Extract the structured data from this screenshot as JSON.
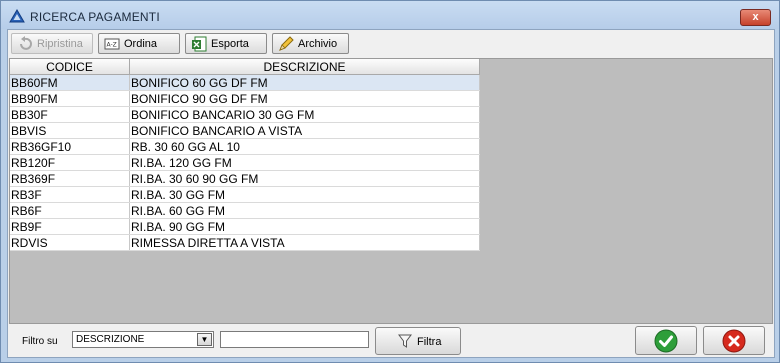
{
  "window": {
    "title": "RICERCA PAGAMENTI",
    "close_label": "x"
  },
  "toolbar": {
    "ripristina_label": "Ripristina",
    "ordina_label": "Ordina",
    "esporta_label": "Esporta",
    "archivio_label": "Archivio"
  },
  "table": {
    "headers": [
      "CODICE",
      "DESCRIZIONE"
    ],
    "rows": [
      [
        "BB60FM",
        "BONIFICO 60 GG DF FM"
      ],
      [
        "BB90FM",
        "BONIFICO 90 GG DF FM"
      ],
      [
        "BB30F",
        "BONIFICO BANCARIO 30 GG FM"
      ],
      [
        "BBVIS",
        "BONIFICO BANCARIO A VISTA"
      ],
      [
        "RB36GF10",
        "RB. 30 60 GG AL 10"
      ],
      [
        "RB120F",
        "RI.BA. 120 GG FM"
      ],
      [
        "RB369F",
        "RI.BA. 30 60 90 GG FM"
      ],
      [
        "RB3F",
        "RI.BA. 30 GG FM"
      ],
      [
        "RB6F",
        "RI.BA. 60 GG FM"
      ],
      [
        "RB9F",
        "RI.BA. 90 GG FM"
      ],
      [
        "RDVIS",
        "RIMESSA DIRETTA A VISTA"
      ]
    ]
  },
  "filter": {
    "label": "Filtro su",
    "field_value": "DESCRIZIONE",
    "text_value": "",
    "filtra_label": "Filtra"
  },
  "colors": {
    "selected_row": "#dbe6f3",
    "title_bar": "#b9cfe8",
    "ok_green": "#2e9e3a",
    "cancel_red": "#d62a1e"
  }
}
